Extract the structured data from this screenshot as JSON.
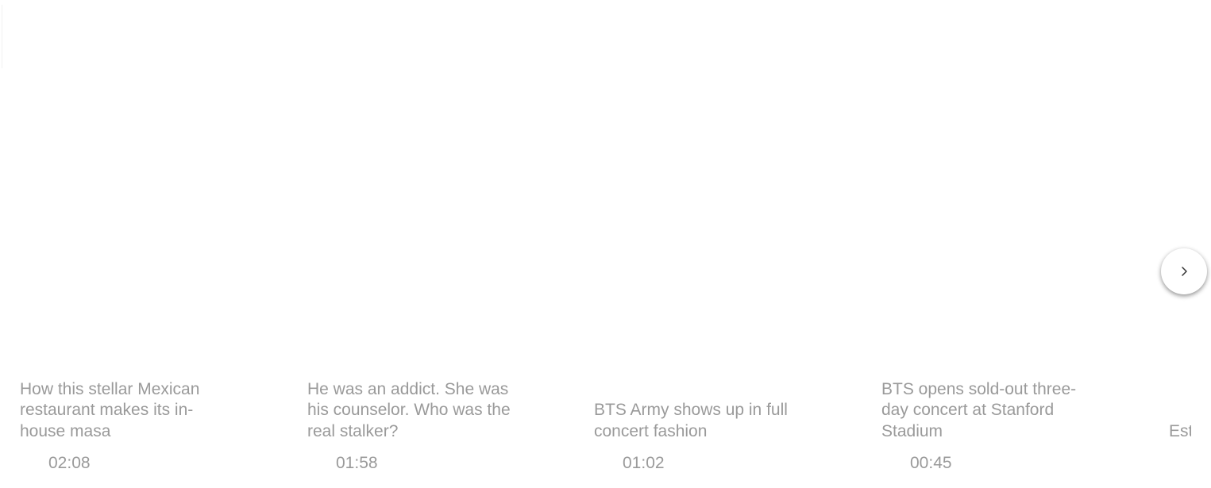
{
  "carousel": {
    "items": [
      {
        "title": "How this stellar Mexican restaurant makes its in-house masa",
        "duration": "02:08"
      },
      {
        "title": "He was an addict. She was his counselor. Who was the real stalker?",
        "duration": "01:58"
      },
      {
        "title": "BTS Army shows up in full concert fashion",
        "duration": "01:02"
      },
      {
        "title": "BTS opens sold-out three-day concert at Stanford Stadium",
        "duration": "00:45"
      },
      {
        "title": "Est res dra",
        "duration": ""
      }
    ],
    "next_icon": "chevron-right-icon"
  },
  "colors": {
    "text": "#9a9a9a",
    "background": "#ffffff"
  }
}
